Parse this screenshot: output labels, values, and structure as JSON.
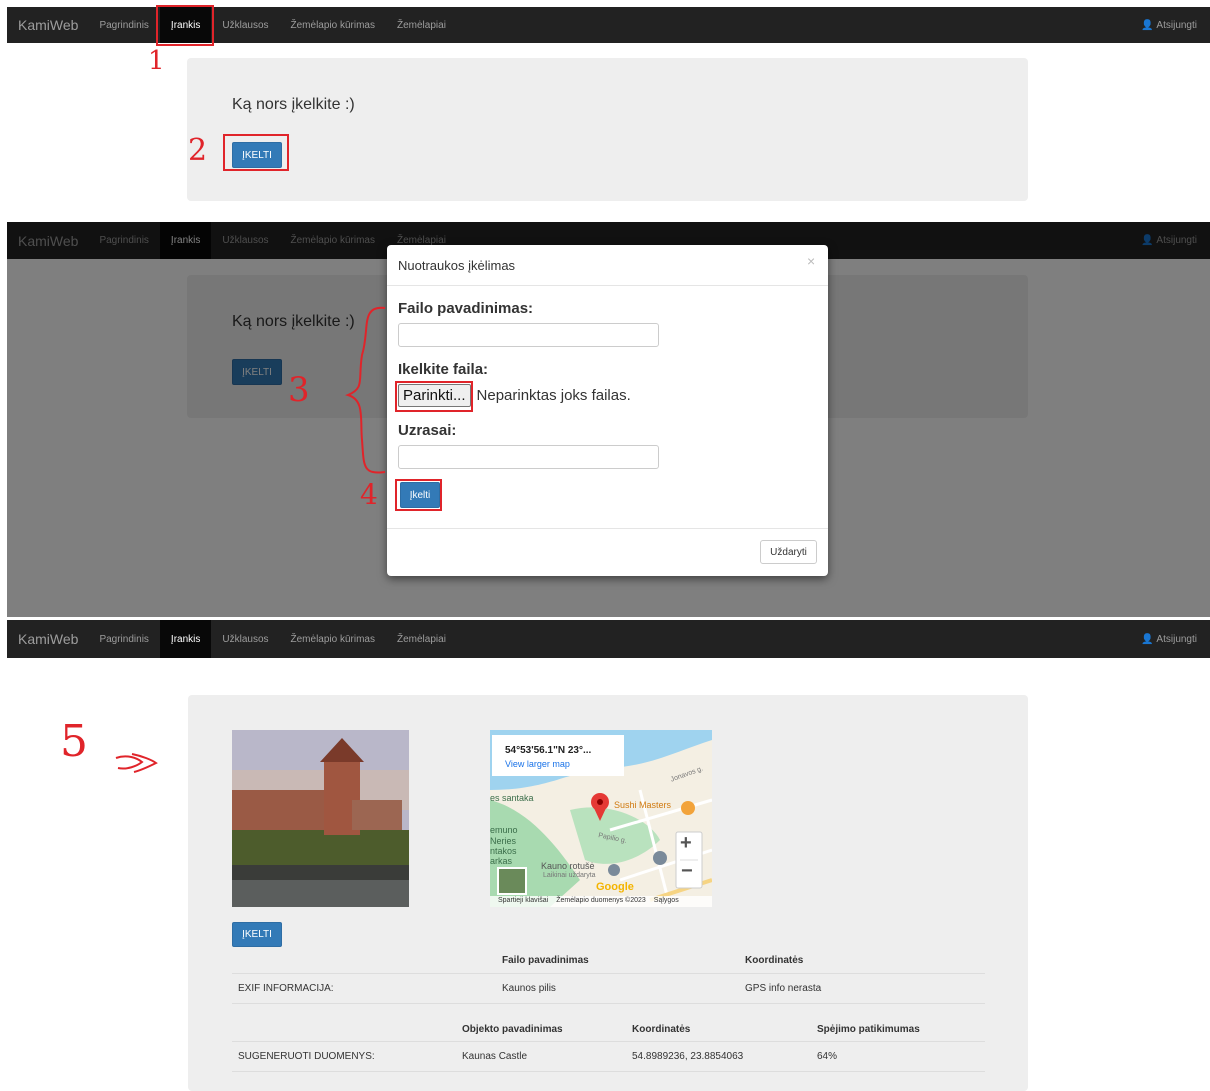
{
  "nav": {
    "brand": "KamiWeb",
    "items": [
      "Pagrindinis",
      "Įrankis",
      "Užklausos",
      "Žemėlapio kūrimas",
      "Žemėlapiai"
    ],
    "logout": "Atsijungti"
  },
  "panel1": {
    "heading": "Ką nors įkelkite :)",
    "upload_button": "ĮKELTI"
  },
  "modal": {
    "title": "Nuotraukos įkėlimas",
    "close": "×",
    "file_name_label": "Failo pavadinimas:",
    "file_upload_label": "Ikelkite faila:",
    "choose_button": "Parinkti...",
    "no_file_text": "Neparinktas joks failas.",
    "notes_label": "Uzrasai:",
    "submit_button": "Įkelti",
    "footer_close": "Uždaryti"
  },
  "result": {
    "upload_button": "ĮKELTI",
    "map": {
      "coords": "54°53'56.1\"N 23°...",
      "larger_map": "View larger map",
      "labels": [
        "es santaka",
        "Sushi Masters",
        "emuno",
        "Neries",
        "ntakos",
        "arkas",
        "Kauno rotušė",
        "Laikinai uždaryta",
        "Papilio g.",
        "Jonavos g."
      ],
      "google": "Google",
      "footer": [
        "Spartieji klavišai",
        "Žemėlapio duomenys ©2023",
        "Sąlygos"
      ],
      "zoom_in": "+",
      "zoom_out": "−"
    },
    "exif": {
      "headers": [
        "Failo pavadinimas",
        "Koordinatės"
      ],
      "row_label": "EXIF INFORMACIJA:",
      "values": [
        "Kaunos pilis",
        "GPS info nerasta"
      ]
    },
    "generated": {
      "headers": [
        "Objekto pavadinimas",
        "Koordinatės",
        "Spėjimo patikimumas"
      ],
      "row_label": "SUGENERUOTI DUOMENYS:",
      "values": [
        "Kaunas Castle",
        "54.8989236, 23.8854063",
        "64%"
      ]
    }
  },
  "annotations": [
    "1",
    "2",
    "3",
    "4",
    "5"
  ],
  "colors": {
    "primary": "#337ab7",
    "navbar": "#222222",
    "annotation": "#e0242a",
    "jumbotron": "#eeeeee"
  }
}
